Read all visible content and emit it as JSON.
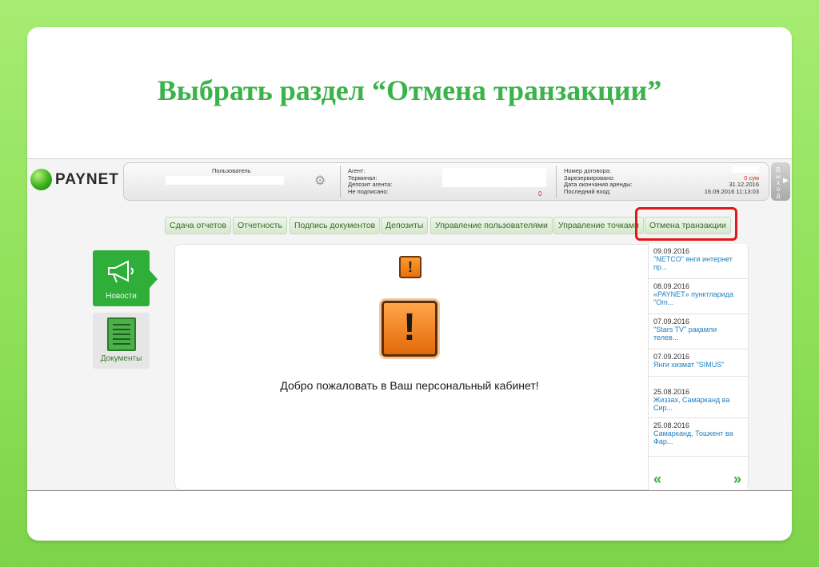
{
  "slide": {
    "title": "Выбрать раздел “Отмена транзакции”"
  },
  "header": {
    "logo_text": "PAYNET",
    "user_label": "Пользователь",
    "agent_labels": [
      "Агент:",
      "Терминал:",
      "Депозит агента:",
      "Не подписано:"
    ],
    "agent_unsigned_value": "0",
    "contract_labels": [
      "Номер договора:",
      "Зарезервировано:",
      "Дата окончания аренды:",
      "Последний вход:"
    ],
    "contract_values": [
      "",
      "0 сум",
      "31.12.2016",
      "16.09.2016 11:13:03"
    ],
    "exit_label": "Выход"
  },
  "nav": {
    "tabs": [
      {
        "label": "Сдача отчетов"
      },
      {
        "label": "Отчетность"
      },
      {
        "label": "Подпись документов"
      },
      {
        "label": "Депозиты"
      },
      {
        "label": "Управление пользователями"
      },
      {
        "label": "Управление точками"
      },
      {
        "label": "Отмена транзакции"
      }
    ],
    "highlight_color": "#e01818"
  },
  "sidebar": {
    "items": [
      {
        "label": "Новости",
        "icon": "megaphone-icon"
      },
      {
        "label": "Документы",
        "icon": "document-icon"
      }
    ]
  },
  "main": {
    "welcome_text": "Добро пожаловать в Ваш персональный кабинет!",
    "warning_icon": "warning-icon"
  },
  "news": {
    "items": [
      {
        "date": "09.09.2016",
        "text": "\"NETCO\" янги интернет пр..."
      },
      {
        "date": "08.09.2016",
        "text": "«PAYNET» пунктларида \"Om..."
      },
      {
        "date": "07.09.2016",
        "text": "\"Stars TV\" рақамли телев..."
      },
      {
        "date": "07.09.2016",
        "text": "Янги хизмат \"SIMUS\""
      },
      {
        "date": "25.08.2016",
        "text": "Жиззах, Самарканд ва Сир..."
      },
      {
        "date": "25.08.2016",
        "text": "Самарканд, Тошкент ва Фар..."
      }
    ],
    "prev_label": "«",
    "next_label": "»"
  },
  "colors": {
    "background": "#8fe05a",
    "title": "#3bb34a",
    "accent_green": "#2fae3a",
    "warning_orange": "#e8700e"
  }
}
